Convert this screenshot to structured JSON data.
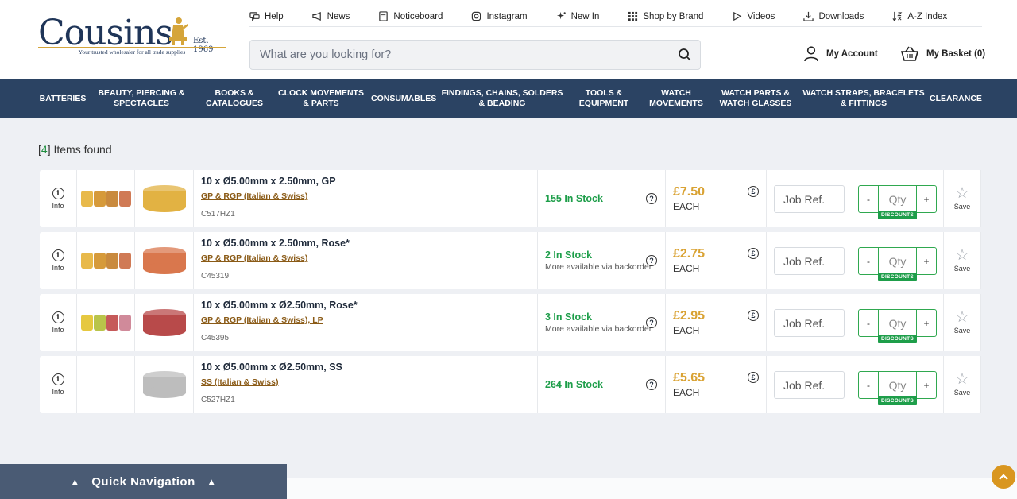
{
  "brand": {
    "name": "Cousins",
    "est": "Est. 1969",
    "tagline": "Your trusted wholesaler for all trade supplies"
  },
  "topnav": [
    {
      "label": "Help",
      "icon": "chat-bubble-icon"
    },
    {
      "label": "News",
      "icon": "megaphone-icon"
    },
    {
      "label": "Noticeboard",
      "icon": "noticeboard-icon"
    },
    {
      "label": "Instagram",
      "icon": "instagram-icon"
    },
    {
      "label": "New In",
      "icon": "sparkle-icon"
    },
    {
      "label": "Shop by Brand",
      "icon": "grid-icon"
    },
    {
      "label": "Videos",
      "icon": "play-icon"
    },
    {
      "label": "Downloads",
      "icon": "download-icon"
    },
    {
      "label": "A-Z Index",
      "icon": "sort-az-icon"
    }
  ],
  "search": {
    "placeholder": "What are you looking for?"
  },
  "account": {
    "label": "My Account"
  },
  "basket": {
    "label": "My Basket (0)"
  },
  "categories": [
    "BATTERIES",
    "BEAUTY, PIERCING & SPECTACLES",
    "BOOKS & CATALOGUES",
    "CLOCK MOVEMENTS & PARTS",
    "CONSUMABLES",
    "FINDINGS, CHAINS, SOLDERS & BEADING",
    "TOOLS & EQUIPMENT",
    "WATCH MOVEMENTS",
    "WATCH PARTS & WATCH GLASSES",
    "WATCH STRAPS, BRACELETS & FITTINGS",
    "CLEARANCE"
  ],
  "results": {
    "count": "4",
    "label": "Items found",
    "info_label": "Info",
    "each_label": "EACH",
    "jobref_placeholder": "Job Ref.",
    "qty_placeholder": "Qty",
    "discounts_label": "DISCOUNTS",
    "save_label": "Save",
    "items": [
      {
        "title": "10 x Ø5.00mm x 2.50mm, GP",
        "category": "GP & RGP (Italian & Swiss)",
        "code": "C517HZ1",
        "stock": "155 In Stock",
        "stock_note": "",
        "price": "£7.50"
      },
      {
        "title": "10 x Ø5.00mm x 2.50mm, Rose*",
        "category": "GP & RGP (Italian & Swiss)",
        "code": "C45319",
        "stock": "2 In Stock",
        "stock_note": "More available via backorder",
        "price": "£2.75"
      },
      {
        "title": "10 x Ø5.00mm x Ø2.50mm, Rose*",
        "category": "GP & RGP (Italian & Swiss), LP",
        "code": "C45395",
        "stock": "3 In Stock",
        "stock_note": "More available via backorder",
        "price": "£2.95"
      },
      {
        "title": "10 x Ø5.00mm x Ø2.50mm, SS",
        "category": "SS (Italian & Swiss)",
        "code": "C527HZ1",
        "stock": "264 In Stock",
        "stock_note": "",
        "price": "£5.65"
      }
    ]
  },
  "quicknav": {
    "label": "Quick Navigation"
  },
  "colors": {
    "navy": "#2b4363",
    "gold": "#d9a233",
    "green": "#1e9e4a",
    "brown_link": "#8a5a16"
  }
}
